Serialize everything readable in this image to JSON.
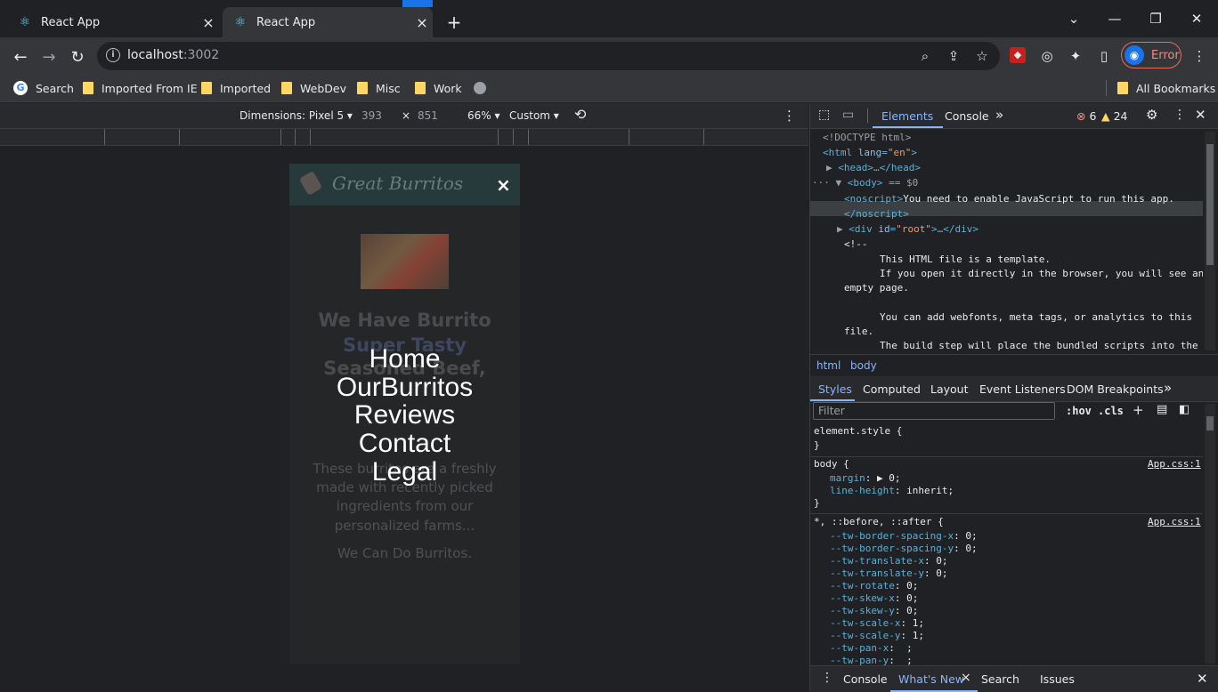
{
  "tabs": [
    {
      "title": "React App",
      "active": false
    },
    {
      "title": "React App",
      "active": true
    }
  ],
  "toolbar": {
    "url_host": "localhost",
    "url_port": ":3002",
    "profile_status": "Error"
  },
  "bookmarks": {
    "items": [
      "Search",
      "Imported From IE",
      "Imported",
      "WebDev",
      "Misc",
      "Work"
    ],
    "all_bookmarks": "All Bookmarks"
  },
  "device_toolbar": {
    "dimensions_label": "Dimensions: Pixel 5",
    "width": "393",
    "times": "×",
    "height": "851",
    "zoom": "66%",
    "throttle": "Custom"
  },
  "phone": {
    "brand": "Great Burritos",
    "close": "×",
    "bg_heading_lines": [
      "We Have Burrito",
      "Super Tasty",
      "Seasoned Beef,",
      "..."
    ],
    "bg_paragraph_lines": [
      "These burritos are a freshly",
      "made with recently picked",
      "ingredients from our",
      "personalized farms..."
    ],
    "bg_tagline": "We Can Do Burritos.",
    "menu": [
      "Home",
      "OurBurritos",
      "Reviews",
      "Contact",
      "Legal"
    ]
  },
  "devtools": {
    "tabs": [
      "Elements",
      "Console"
    ],
    "errors": "6",
    "warnings": "24",
    "dom_lines": [
      "<!DOCTYPE html>",
      "<html lang=\"en\">",
      "<head>…</head>",
      "<body> == $0",
      "<noscript>You need to enable JavaScript to run this app.",
      "</noscript>",
      "<div id=\"root\">…</div>",
      "<!--",
      "This HTML file is a template.",
      "If you open it directly in the browser, you will see an",
      "empty page.",
      "You can add webfonts, meta tags, or analytics to this",
      "file.",
      "The build step will place the bundled scripts into the"
    ],
    "breadcrumbs": [
      "html",
      "body"
    ],
    "style_tabs": [
      "Styles",
      "Computed",
      "Layout",
      "Event Listeners",
      "DOM Breakpoints"
    ],
    "filter_placeholder": "Filter",
    "hov": ":hov",
    "cls": ".cls",
    "rules": {
      "element_style": "element.style {",
      "body_selector": "body {",
      "body_source": "App.css:1",
      "body_props": [
        [
          "margin",
          "▶ 0;"
        ],
        [
          "line-height",
          "inherit;"
        ]
      ],
      "universal_selector": "*, ::before, ::after {",
      "universal_source": "App.css:1",
      "universal_props": [
        [
          "--tw-border-spacing-x",
          "0;"
        ],
        [
          "--tw-border-spacing-y",
          "0;"
        ],
        [
          "--tw-translate-x",
          "0;"
        ],
        [
          "--tw-translate-y",
          "0;"
        ],
        [
          "--tw-rotate",
          "0;"
        ],
        [
          "--tw-skew-x",
          "0;"
        ],
        [
          "--tw-skew-y",
          "0;"
        ],
        [
          "--tw-scale-x",
          "1;"
        ],
        [
          "--tw-scale-y",
          "1;"
        ],
        [
          "--tw-pan-x",
          " ;"
        ],
        [
          "--tw-pan-y",
          " ;"
        ]
      ]
    },
    "drawer_tabs": [
      "Console",
      "What's New",
      "Search",
      "Issues"
    ]
  }
}
